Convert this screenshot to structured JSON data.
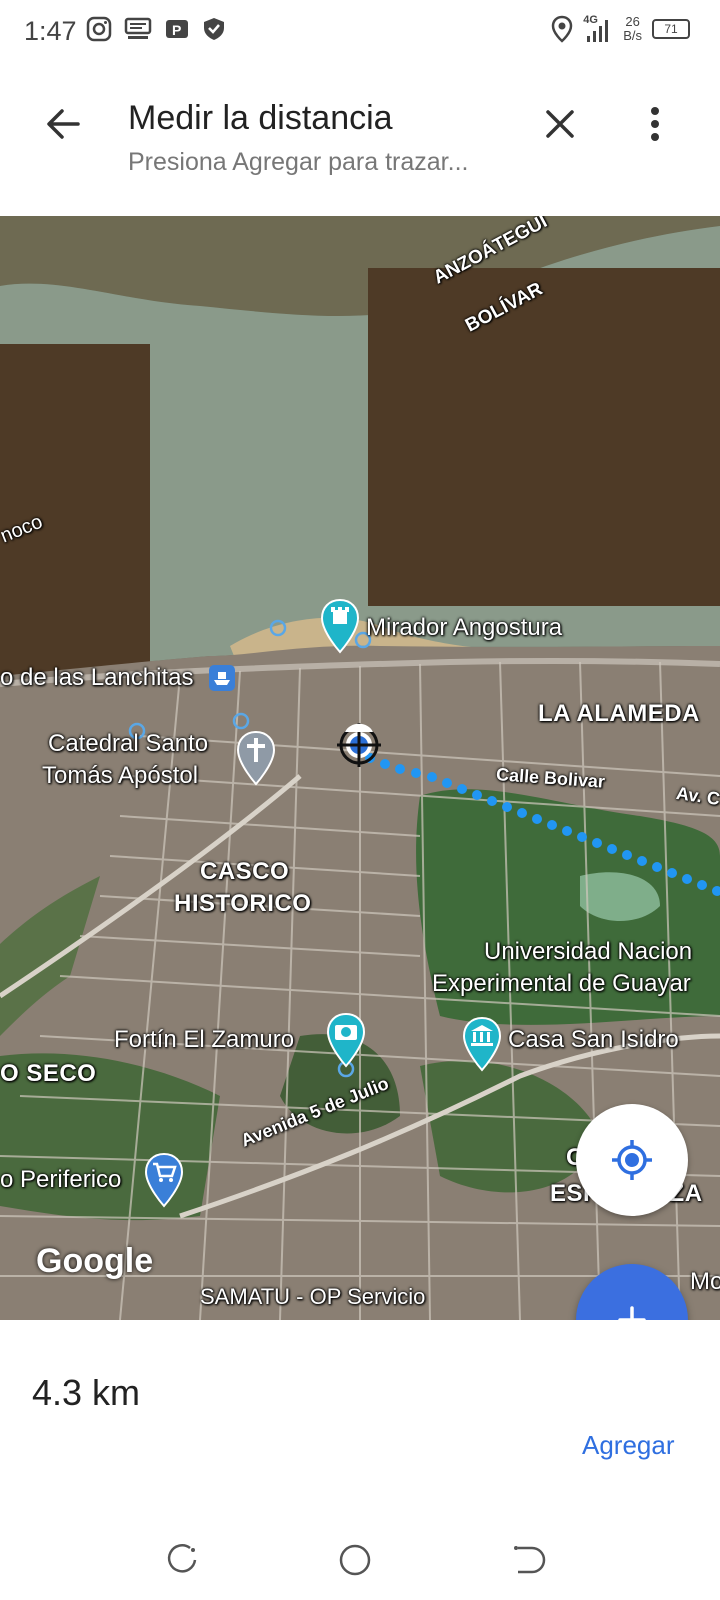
{
  "status_bar": {
    "time": "1:47",
    "network": "4G",
    "speed_value": "26",
    "speed_unit": "B/s",
    "battery": "71",
    "icons": [
      "instagram-icon",
      "notification-icon",
      "parking-icon",
      "shield-icon",
      "location-icon",
      "signal-icon",
      "battery-icon"
    ]
  },
  "toolbar": {
    "title": "Medir la distancia",
    "subtitle": "Presiona Agregar para trazar...",
    "back_icon": "arrow-back-icon",
    "close_icon": "close-icon",
    "more_icon": "more-vert-icon"
  },
  "map": {
    "labels": {
      "anzoategui": "ANZOÁTEGUI",
      "bolivar": "BOLÍVAR",
      "orinoco": "noco",
      "mirador": "Mirador Angostura",
      "lanchitas": "o de las Lanchitas",
      "la_alameda": "LA ALAMEDA",
      "catedral_1": "Catedral Santo",
      "catedral_2": "Tomás Apóstol",
      "calle_bolivar": "Calle Bolivar",
      "av": "Av. C",
      "casco_1": "CASCO",
      "casco_2": "HISTORICO",
      "universidad_1": "Universidad Nacion",
      "universidad_2": "Experimental de Guayar",
      "fortin": "Fortín El Zamuro",
      "casa": "Casa San Isidro",
      "seco": "O SECO",
      "avenida": "Avenida 5 de Julio",
      "periferico": "o Periferico",
      "esperanza_1": "C          A",
      "esperanza_2": "ESPERANZA",
      "samatu": "SAMATU - OP Servicio",
      "mo": "Mo"
    },
    "logo": "Google"
  },
  "fabs": {
    "location_icon": "my-location-icon",
    "add_icon": "plus-icon"
  },
  "measurement": {
    "distance": "4.3 km",
    "add_label": "Agregar"
  },
  "colors": {
    "accent": "#3b6fe0",
    "link": "#2f6fe0",
    "dotted_line": "#2196f3",
    "poi_teal": "#1fb5c9"
  }
}
